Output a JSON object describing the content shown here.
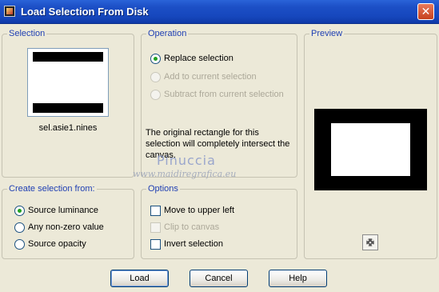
{
  "window": {
    "title": "Load Selection From Disk",
    "close_glyph": "✕"
  },
  "selection": {
    "label": "Selection",
    "file_name": "sel.asie1.nines"
  },
  "operation": {
    "label": "Operation",
    "options": [
      {
        "label": "Replace selection",
        "checked": true,
        "enabled": true
      },
      {
        "label": "Add to current selection",
        "checked": false,
        "enabled": false
      },
      {
        "label": "Subtract from current selection",
        "checked": false,
        "enabled": false
      }
    ],
    "info": "The original rectangle for this selection will completely intersect the canvas."
  },
  "preview": {
    "label": "Preview"
  },
  "create_from": {
    "label": "Create selection from:",
    "options": [
      {
        "label": "Source luminance",
        "checked": true
      },
      {
        "label": "Any non-zero value",
        "checked": false
      },
      {
        "label": "Source opacity",
        "checked": false
      }
    ]
  },
  "options": {
    "label": "Options",
    "items": [
      {
        "label": "Move to upper left",
        "checked": false,
        "enabled": true
      },
      {
        "label": "Clip to canvas",
        "checked": false,
        "enabled": false
      },
      {
        "label": "Invert selection",
        "checked": false,
        "enabled": true
      }
    ]
  },
  "buttons": {
    "load": "Load",
    "cancel": "Cancel",
    "help": "Help"
  },
  "watermark": {
    "name": "Pinuccia",
    "url": "www.maidiregrafica.eu"
  }
}
